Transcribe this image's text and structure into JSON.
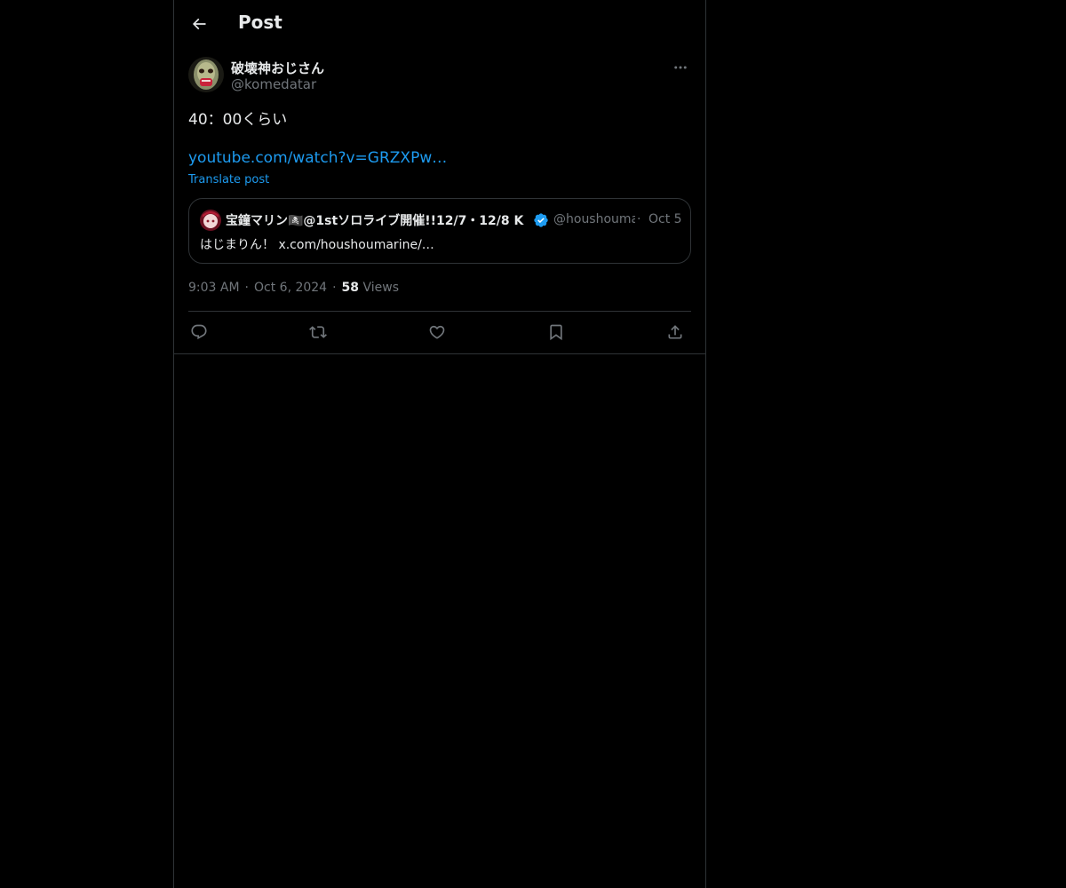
{
  "header": {
    "title": "Post"
  },
  "post": {
    "author_name": "破壊神おじさん",
    "author_handle": "@komedatar",
    "text": "40：00くらい",
    "link": "youtube.com/watch?v=GRZXPw…",
    "translate_label": "Translate post",
    "time": "9:03 AM",
    "date": "Oct 6, 2024",
    "view_count": "58",
    "views_label": "Views"
  },
  "quote": {
    "author_name": "宝鐘マリン🏴‍☠️@1stソロライブ開催!!12/7・12/8 K",
    "author_handle": "@houshoumarine",
    "date": "Oct 5",
    "text": "はじまりん！ x.com/houshoumarine/…"
  },
  "icons": {
    "back": "arrow-left-icon",
    "more": "more-horizontal-icon",
    "reply": "reply-icon",
    "repost": "repost-icon",
    "like": "heart-icon",
    "bookmark": "bookmark-icon",
    "share": "share-icon",
    "verified": "verified-badge-icon"
  },
  "colors": {
    "background": "#000000",
    "text": "#e7e9ea",
    "secondary": "#71767b",
    "accent": "#1d9bf0",
    "border": "#2f3336"
  }
}
